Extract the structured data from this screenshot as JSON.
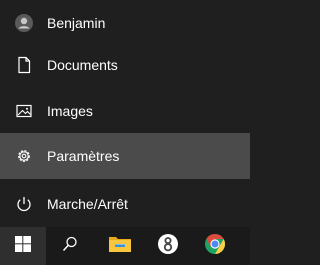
{
  "start_menu": {
    "items": [
      {
        "label": "Benjamin",
        "icon": "user-avatar-icon"
      },
      {
        "label": "Documents",
        "icon": "document-icon"
      },
      {
        "label": "Images",
        "icon": "images-icon"
      },
      {
        "label": "Paramètres",
        "icon": "gear-icon"
      },
      {
        "label": "Marche/Arrêt",
        "icon": "power-icon"
      }
    ],
    "highlighted_item": "Paramètres"
  },
  "taskbar": {
    "icons": [
      "windows-start-icon",
      "search-icon",
      "file-explorer-icon",
      "app-8-icon",
      "chrome-icon"
    ]
  },
  "colors": {
    "menu_bg": "#1f1f1f",
    "highlight_bg": "#4b4b4b",
    "taskbar_bg": "#1a1a1a",
    "windows_blue": "#00a2ed"
  }
}
